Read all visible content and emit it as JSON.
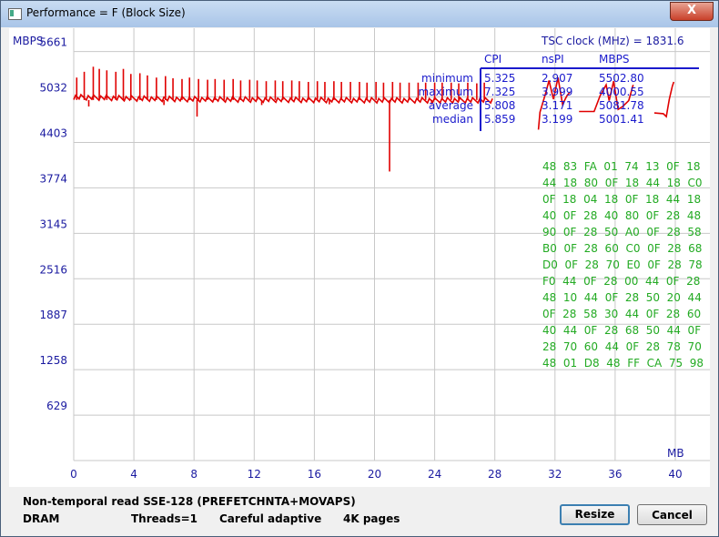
{
  "window": {
    "title": "Performance = F (Block Size)",
    "close_label": "X"
  },
  "plot": {
    "y_unit": "MBPS",
    "x_unit": "MB",
    "tsc_clock": "TSC clock (MHz)  = 1831.6",
    "line_color": "#e00000",
    "axis_text_color": "#1a1aa0",
    "hex_text_color": "#22aa22"
  },
  "stats": {
    "headers": [
      "CPI",
      "nsPI",
      "MBPS"
    ],
    "rows": [
      {
        "label": "minimum",
        "cpi": "5.325",
        "nspi": "2.907",
        "mbps": "5502.80"
      },
      {
        "label": "maximum",
        "cpi": "7.325",
        "nspi": "3.999",
        "mbps": "4000.55"
      },
      {
        "label": "average",
        "cpi": "5.808",
        "nspi": "3.171",
        "mbps": "5081.78"
      },
      {
        "label": "median",
        "cpi": "5.859",
        "nspi": "3.199",
        "mbps": "5001.41"
      }
    ]
  },
  "hex_dump": [
    "48  83  FA  01  74  13  0F  18",
    "44  18  80  0F  18  44  18  C0",
    "0F  18  04  18  0F  18  44  18",
    "40  0F  28  40  80  0F  28  48",
    "90  0F  28  50  A0  0F  28  58",
    "B0  0F  28  60  C0  0F  28  68",
    "D0  0F  28  70  E0  0F  28  78",
    "F0  44  0F  28  00  44  0F  28",
    "48  10  44  0F  28  50  20  44",
    "0F  28  58  30  44  0F  28  60",
    "40  44  0F  28  68  50  44  0F",
    "28  70  60  44  0F  28  78  70",
    "48  01  D8  48  FF  CA  75  98"
  ],
  "status": {
    "test_name": "Non-temporal read SSE-128 (PREFETCHNTA+MOVAPS)",
    "memory": "DRAM",
    "threads": "Threads=1",
    "mode": "Careful adaptive",
    "pages": "4K pages"
  },
  "buttons": {
    "resize": "Resize",
    "cancel": "Cancel"
  },
  "chart_data": {
    "type": "line",
    "xlabel": "MB",
    "ylabel": "MBPS",
    "x_ticks": [
      0,
      4,
      8,
      12,
      16,
      20,
      24,
      28,
      32,
      36,
      40
    ],
    "y_ticks": [
      629,
      1258,
      1887,
      2516,
      3145,
      3774,
      4403,
      5032,
      5661
    ],
    "xlim": [
      0,
      42.3
    ],
    "ylim": [
      0,
      5920
    ],
    "grid": true,
    "series": [
      {
        "baseline": [
          [
            0,
            5030
          ],
          [
            4,
            5010
          ],
          [
            8,
            5000
          ],
          [
            12,
            4995
          ],
          [
            16,
            4990
          ],
          [
            20,
            4985
          ],
          [
            24,
            4985
          ],
          [
            27.9,
            4985
          ]
        ],
        "spikes_up": [
          [
            0.2,
            5300
          ],
          [
            0.7,
            5380
          ],
          [
            1.3,
            5450
          ],
          [
            1.7,
            5420
          ],
          [
            2.2,
            5400
          ],
          [
            2.8,
            5380
          ],
          [
            3.3,
            5420
          ],
          [
            3.8,
            5350
          ],
          [
            4.4,
            5360
          ],
          [
            4.9,
            5330
          ],
          [
            5.5,
            5300
          ],
          [
            6.1,
            5320
          ],
          [
            6.6,
            5290
          ],
          [
            7.2,
            5280
          ],
          [
            7.7,
            5300
          ],
          [
            8.3,
            5280
          ],
          [
            8.9,
            5270
          ],
          [
            9.4,
            5280
          ],
          [
            10.0,
            5270
          ],
          [
            10.6,
            5280
          ],
          [
            11.1,
            5260
          ],
          [
            11.7,
            5270
          ],
          [
            12.2,
            5260
          ],
          [
            12.8,
            5250
          ],
          [
            13.4,
            5260
          ],
          [
            13.9,
            5250
          ],
          [
            14.5,
            5260
          ],
          [
            15.0,
            5250
          ],
          [
            15.6,
            5240
          ],
          [
            16.2,
            5250
          ],
          [
            16.7,
            5240
          ],
          [
            17.3,
            5250
          ],
          [
            17.8,
            5240
          ],
          [
            18.4,
            5240
          ],
          [
            19.0,
            5240
          ],
          [
            19.5,
            5230
          ],
          [
            20.1,
            5240
          ],
          [
            20.6,
            5230
          ],
          [
            21.2,
            5240
          ],
          [
            21.7,
            5230
          ],
          [
            22.3,
            5230
          ],
          [
            22.9,
            5230
          ],
          [
            23.4,
            5230
          ],
          [
            24.0,
            5230
          ],
          [
            24.5,
            5230
          ],
          [
            25.1,
            5230
          ],
          [
            25.6,
            5220
          ],
          [
            26.2,
            5230
          ],
          [
            26.8,
            5220
          ],
          [
            27.3,
            5230
          ]
        ],
        "dips": [
          [
            8.2,
            4760
          ],
          [
            21.0,
            4000
          ],
          [
            1.0,
            4900
          ],
          [
            6.0,
            4920
          ],
          [
            12.5,
            4920
          ],
          [
            17.0,
            4930
          ],
          [
            23.8,
            4930
          ]
        ],
        "segment_2": [
          [
            30.9,
            4580
          ],
          [
            31.0,
            4820
          ],
          [
            31.4,
            5100
          ],
          [
            31.6,
            5260
          ],
          [
            31.9,
            5000
          ],
          [
            32.2,
            5300
          ],
          [
            32.5,
            4930
          ],
          [
            32.8,
            5050
          ],
          [
            33.0,
            5100
          ]
        ],
        "segment_3": [
          [
            33.6,
            4830
          ],
          [
            34.6,
            4830
          ],
          [
            35.0,
            5050
          ],
          [
            35.4,
            5200
          ],
          [
            35.6,
            4980
          ],
          [
            35.9,
            5250
          ],
          [
            36.2,
            4860
          ],
          [
            36.5,
            4900
          ],
          [
            36.9,
            4980
          ],
          [
            37.2,
            5200
          ]
        ],
        "segment_4": [
          [
            38.6,
            4810
          ],
          [
            39.2,
            4800
          ],
          [
            39.4,
            4760
          ],
          [
            39.6,
            5000
          ],
          [
            39.8,
            5180
          ],
          [
            39.9,
            5240
          ]
        ]
      }
    ]
  }
}
